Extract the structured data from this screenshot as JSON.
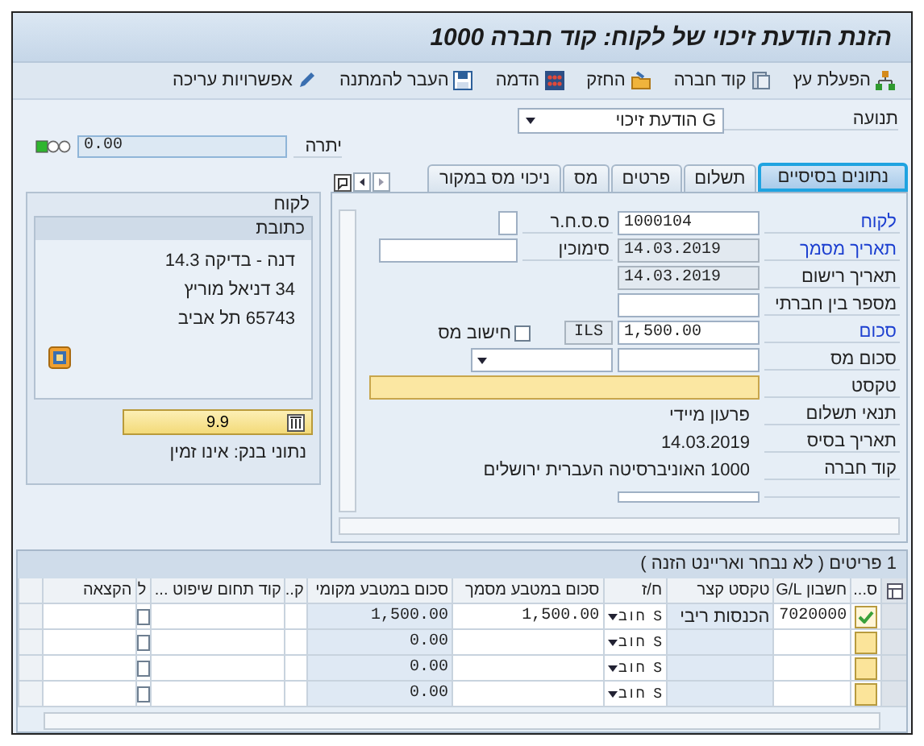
{
  "window": {
    "title": "הזנת הודעת זיכוי של לקוח: קוד חברה 1000"
  },
  "toolbar": [
    "הפעלת עץ",
    "קוד חברה",
    "החזק",
    "הדמה",
    "העבר להמתנה",
    "אפשרויות עריכה"
  ],
  "transaction": {
    "label": "תנועה",
    "value": "G הודעת זיכוי"
  },
  "balance": {
    "label": "יתרה",
    "value": "0.00"
  },
  "customer_panel": {
    "title": "לקוח",
    "address_title": "כתובת",
    "address_lines": [
      "דנה - בדיקה 14.3",
      "34 דניאל מוריץ",
      "65743 תל אביב"
    ],
    "bank_button": "9.9",
    "bank_note": "נתוני בנק: אינו זמין"
  },
  "tabs": [
    {
      "label": "נתונים בסיסיים",
      "selected": true
    },
    {
      "label": "תשלום",
      "selected": false
    },
    {
      "label": "פרטים",
      "selected": false
    },
    {
      "label": "מס",
      "selected": false
    },
    {
      "label": "ניכוי מס במקור",
      "selected": false
    }
  ],
  "form": [
    {
      "label": "לקוח",
      "link": true,
      "field": {
        "kind": "input",
        "value": "1000104"
      },
      "extra": [
        {
          "kind": "label",
          "text": "ס.ס.ח.ר"
        },
        {
          "kind": "small_input"
        }
      ]
    },
    {
      "label": "תאריך מסמך",
      "link": true,
      "field": {
        "kind": "readonly",
        "value": "14.03.2019"
      },
      "extra": [
        {
          "kind": "label",
          "text": "סימוכין"
        },
        {
          "kind": "input"
        }
      ]
    },
    {
      "label": "תאריך רישום",
      "link": false,
      "field": {
        "kind": "readonly",
        "value": "14.03.2019"
      }
    },
    {
      "label": "מספר בין חברתי",
      "link": false,
      "field": {
        "kind": "input"
      }
    },
    {
      "label": "סכום",
      "link": true,
      "field": {
        "kind": "input",
        "value": "1,500.00"
      },
      "extra": [
        {
          "kind": "readonly",
          "text": "ILS"
        },
        {
          "kind": "checkbox",
          "text": "חישוב מס",
          "checked": false
        }
      ]
    },
    {
      "label": "סכום מס",
      "link": false,
      "field": {
        "kind": "input"
      },
      "extra": [
        {
          "kind": "dropdown"
        }
      ]
    },
    {
      "label": "טקסט",
      "link": false,
      "field": {
        "kind": "wide"
      }
    },
    {
      "label": "תנאי תשלום",
      "link": false,
      "field": {
        "kind": "text",
        "value": "פרעון מיידי"
      }
    },
    {
      "label": "תאריך בסיס",
      "link": false,
      "field": {
        "kind": "text",
        "value": "14.03.2019"
      }
    },
    {
      "label": "קוד חברה",
      "link": false,
      "field": {
        "kind": "text",
        "value": "1000 האוניברסיטה העברית ירושלים"
      }
    }
  ],
  "items": {
    "title": "1 פריטים ( לא נבחר ואריינט הזנה )",
    "columns": [
      "ס...",
      "חשבון G/L",
      "טקסט קצר",
      "ח/ז",
      "סכום במטבע מסמך",
      "סכום במטבע מקומי",
      "ק..",
      "קוד תחום שיפוט ...",
      "ל",
      "הקצאה"
    ],
    "rows": [
      {
        "ok": true,
        "account": "7020000",
        "short_text": "הכנסות ריבי",
        "dc": "S חוב",
        "doc_amount": "1,500.00",
        "local_amount": "1,500.00",
        "flag": false
      },
      {
        "ok": false,
        "dc": "S חוב",
        "local_amount": "0.00",
        "flag": false
      },
      {
        "ok": false,
        "dc": "S חוב",
        "local_amount": "0.00",
        "flag": false
      },
      {
        "ok": false,
        "dc": "S חוב",
        "local_amount": "0.00",
        "flag": false
      }
    ]
  }
}
